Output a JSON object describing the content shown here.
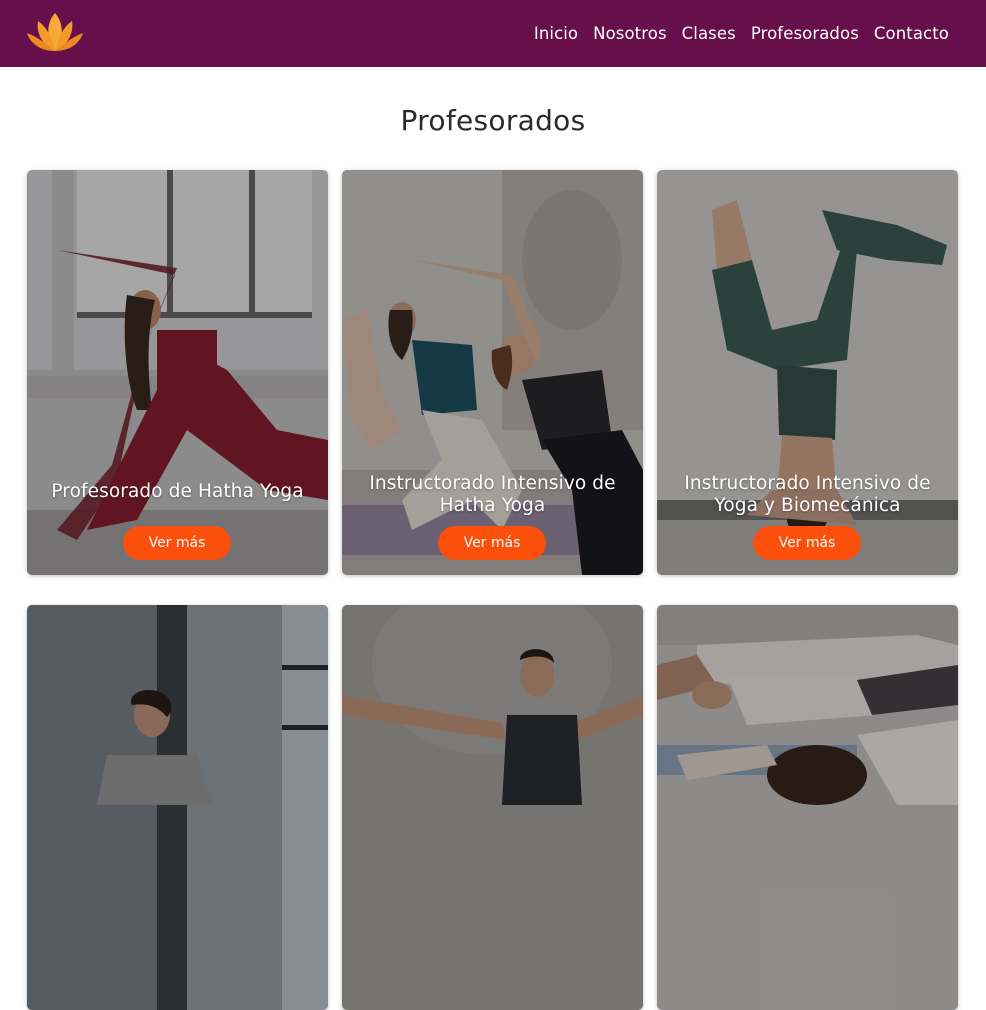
{
  "header": {
    "logo_icon": "lotus-icon",
    "nav": [
      {
        "label": "Inicio"
      },
      {
        "label": "Nosotros"
      },
      {
        "label": "Clases"
      },
      {
        "label": "Profesorados"
      },
      {
        "label": "Contacto"
      }
    ]
  },
  "main": {
    "title": "Profesorados",
    "cards": [
      {
        "title": "Profesorado de Hatha Yoga",
        "button": "Ver más"
      },
      {
        "title": "Instructorado Intensivo de Hatha Yoga",
        "button": "Ver más"
      },
      {
        "title": "Instructorado Intensivo de Yoga y Biomecánica",
        "button": "Ver más"
      },
      {
        "title": "",
        "button": ""
      },
      {
        "title": "",
        "button": ""
      },
      {
        "title": "",
        "button": ""
      }
    ]
  },
  "colors": {
    "header_bg": "#660f4b",
    "button_bg": "#fb4f0c",
    "logo": "#f2a030"
  }
}
